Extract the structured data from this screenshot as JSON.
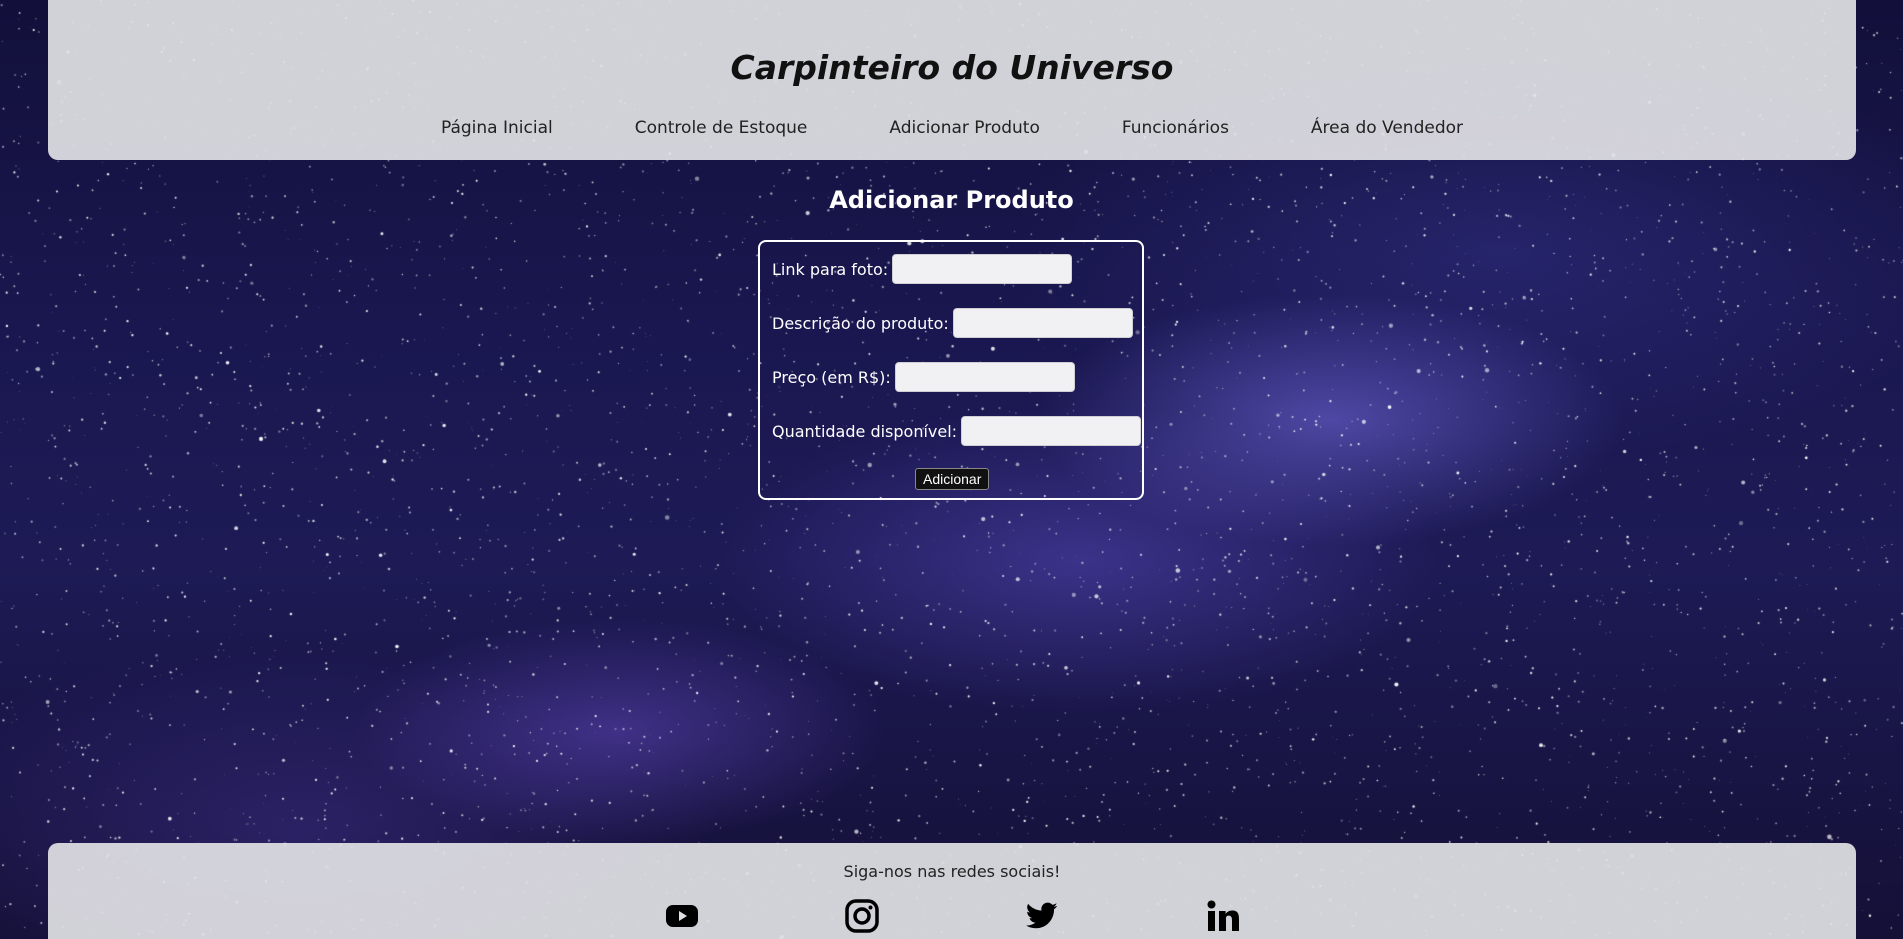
{
  "header": {
    "title": "Carpinteiro do Universo",
    "nav": [
      {
        "label": "Página Inicial"
      },
      {
        "label": "Controle de Estoque"
      },
      {
        "label": "Adicionar Produto"
      },
      {
        "label": "Funcionários"
      },
      {
        "label": "Área do Vendedor"
      }
    ]
  },
  "main": {
    "heading": "Adicionar Produto",
    "form": {
      "fields": [
        {
          "label": "Link para foto:",
          "value": "",
          "placeholder": ""
        },
        {
          "label": "Descrição do produto:",
          "value": "",
          "placeholder": ""
        },
        {
          "label": "Preço (em R$):",
          "value": "",
          "placeholder": ""
        },
        {
          "label": "Quantidade disponível:",
          "value": "",
          "placeholder": ""
        }
      ],
      "submit_label": "Adicionar"
    }
  },
  "footer": {
    "text": "Siga-nos nas redes sociais!",
    "social": [
      {
        "icon": "youtube-icon"
      },
      {
        "icon": "instagram-icon"
      },
      {
        "icon": "twitter-icon"
      },
      {
        "icon": "linkedin-icon"
      }
    ]
  },
  "colors": {
    "panel": "#e0e0e4",
    "background": "#1a1750",
    "form_border": "#ffffff",
    "text_dark": "#111111"
  }
}
